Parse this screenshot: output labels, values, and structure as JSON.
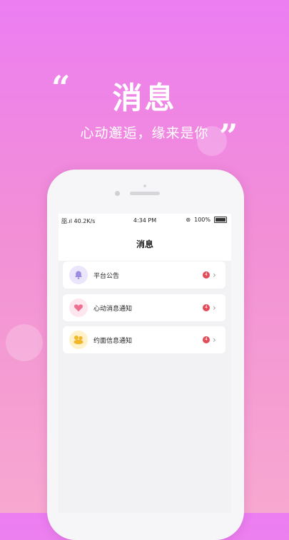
{
  "promo": {
    "headline": "消息",
    "tagline": "心动邂逅，缘来是你",
    "open_quote": "“",
    "close_quote": "”"
  },
  "status_bar": {
    "signal": "㗊.ıl 40.2K/s",
    "time": "4:34 PM",
    "battery": "100%"
  },
  "nav": {
    "title": "消息"
  },
  "messages": [
    {
      "label": "平台公告",
      "icon": "bell-icon",
      "badge": "4"
    },
    {
      "label": "心动消息通知",
      "icon": "heart-icon",
      "badge": "4"
    },
    {
      "label": "约面信息通知",
      "icon": "coin-icon",
      "badge": "4"
    }
  ],
  "colors": {
    "bg_top": "#ec7ef2",
    "bg_bottom": "#f7a8d0",
    "badge": "#e24b57",
    "bell": "#9b8ce0",
    "heart": "#ec6f8f",
    "coin": "#f1b62a"
  }
}
